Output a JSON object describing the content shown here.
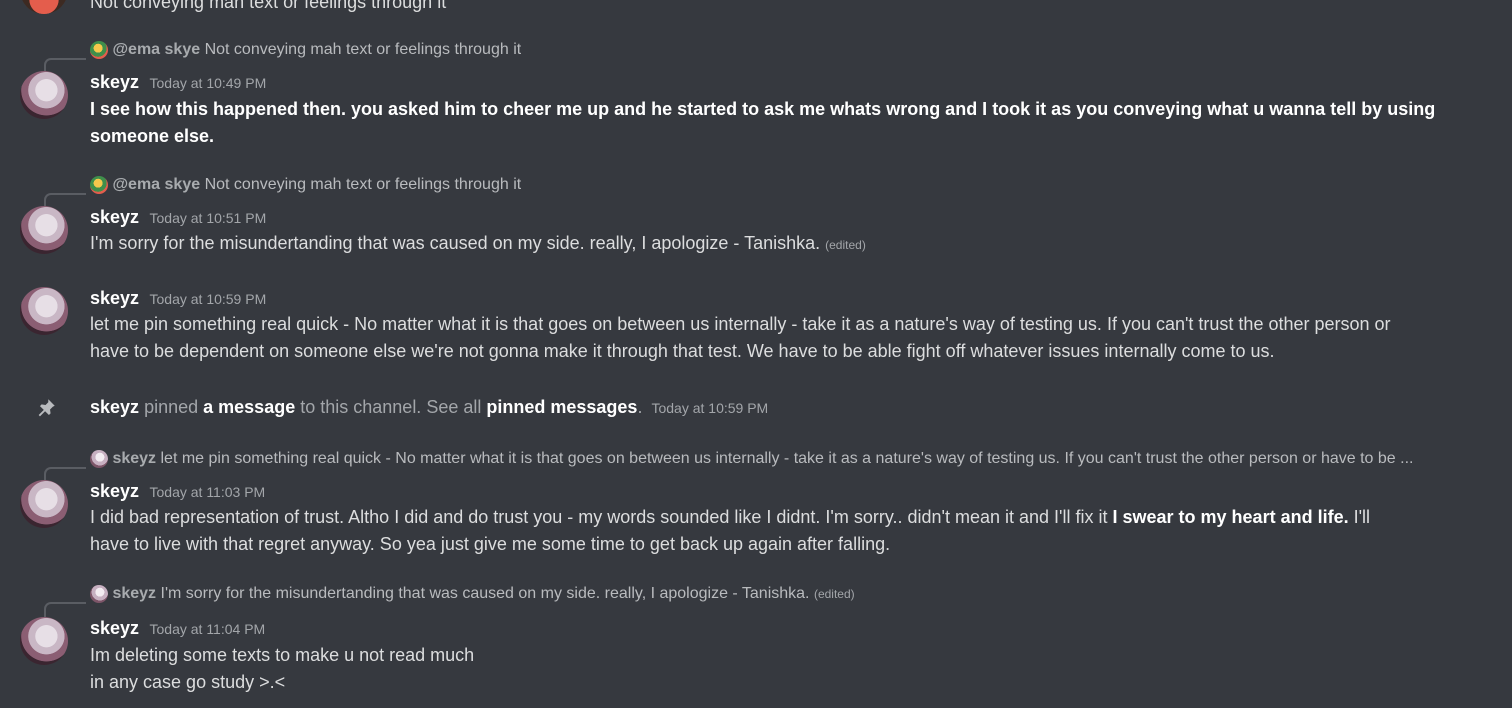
{
  "top_fragment": {
    "text": "Not conveying mah text or feelings through it"
  },
  "messages": [
    {
      "reply": {
        "author": "@ema skye",
        "text": "Not conveying mah text or feelings through it"
      },
      "author": "skeyz",
      "time": "Today at 10:49 PM",
      "line1": "I see how this happened then. you asked him to cheer me up and he started to ask me whats wrong and I took it as you conveying what u wanna tell by using",
      "line2": "someone else."
    },
    {
      "reply": {
        "author": "@ema skye",
        "text": "Not conveying mah text or feelings through it"
      },
      "author": "skeyz",
      "time": "Today at 10:51 PM",
      "text": "I'm sorry for the misundertanding that was caused on my side. really, I apologize - Tanishka.",
      "edited": "(edited)"
    },
    {
      "author": "skeyz",
      "time": "Today at 10:59 PM",
      "line1": "let me pin something real quick - No matter what it is that goes on between us internally - take it as a nature's way of testing us. If you can't trust the other person or",
      "line2": "have to be dependent on someone else we're not gonna make it through that test. We have to be able fight off whatever issues internally come to us."
    },
    {
      "reply": {
        "author": "skeyz",
        "text": "let me pin something real quick - No matter what it is that goes on between us internally - take it as a nature's way of testing us. If you can't trust the other person or have to be ..."
      },
      "author": "skeyz",
      "time": "Today at 11:03 PM",
      "line1_a": "I did bad representation of trust. Altho I did and do trust you - my words sounded like I didnt. I'm sorry.. didn't mean it and I'll fix it",
      "line1_bold": "I swear to my heart and life.",
      "line1_b": "I'll",
      "line2": "have to live with that regret anyway. So yea just give me some time to get back up again after falling."
    },
    {
      "reply": {
        "author": "skeyz",
        "text": "I'm sorry for the misundertanding that was caused on my side. really, I apologize - Tanishka.",
        "edited": "(edited)"
      },
      "author": "skeyz",
      "time": "Today at 11:04 PM",
      "line1": "Im deleting some texts to make u not read much",
      "line2": "in any case go study >.<"
    }
  ],
  "system_pin": {
    "author": "skeyz",
    "pinned": "pinned",
    "a_message": "a message",
    "to_channel": "to this channel. See all",
    "pinned_messages": "pinned messages",
    "period": ".",
    "time": "Today at 10:59 PM"
  },
  "colors": {
    "background": "#36393f",
    "text": "#dcddde",
    "username": "#ffffff",
    "muted": "#a3a6aa"
  },
  "icons": {
    "pin": "pin-icon"
  }
}
